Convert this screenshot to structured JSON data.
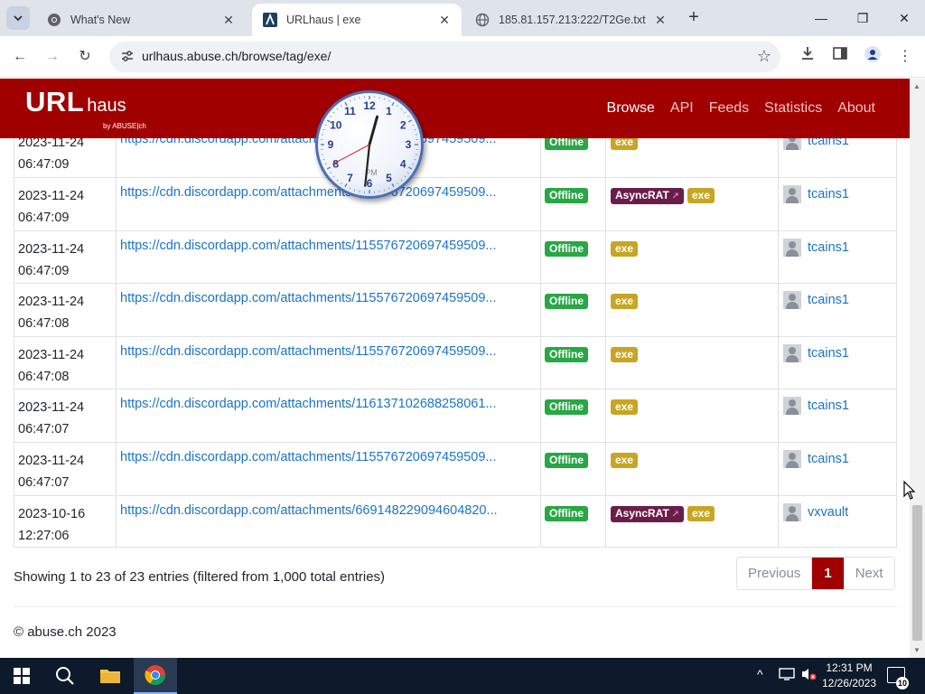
{
  "browser": {
    "tabs": [
      {
        "title": "What's New",
        "active": false
      },
      {
        "title": "URLhaus | exe",
        "active": true
      },
      {
        "title": "185.81.157.213:222/T2Ge.txt",
        "active": false
      }
    ],
    "url": "urlhaus.abuse.ch/browse/tag/exe/"
  },
  "site": {
    "logo_main": "URL",
    "logo_sub": "haus",
    "logo_by": "by ABUSE|ch",
    "nav": [
      "Browse",
      "API",
      "Feeds",
      "Statistics",
      "About"
    ],
    "active_nav": "Browse"
  },
  "table": {
    "rows": [
      {
        "date": "2023-11-24",
        "time": "06:47:09",
        "url": "https://cdn.discordapp.com/attachments/115576720697459509...",
        "status": "Offline",
        "tags": [
          "exe"
        ],
        "reporter": "tcains1"
      },
      {
        "date": "2023-11-24",
        "time": "06:47:09",
        "url": "https://cdn.discordapp.com/attachments/115576720697459509...",
        "status": "Offline",
        "tags": [
          "AsyncRAT",
          "exe"
        ],
        "reporter": "tcains1"
      },
      {
        "date": "2023-11-24",
        "time": "06:47:09",
        "url": "https://cdn.discordapp.com/attachments/115576720697459509...",
        "status": "Offline",
        "tags": [
          "exe"
        ],
        "reporter": "tcains1"
      },
      {
        "date": "2023-11-24",
        "time": "06:47:08",
        "url": "https://cdn.discordapp.com/attachments/115576720697459509...",
        "status": "Offline",
        "tags": [
          "exe"
        ],
        "reporter": "tcains1"
      },
      {
        "date": "2023-11-24",
        "time": "06:47:08",
        "url": "https://cdn.discordapp.com/attachments/115576720697459509...",
        "status": "Offline",
        "tags": [
          "exe"
        ],
        "reporter": "tcains1"
      },
      {
        "date": "2023-11-24",
        "time": "06:47:07",
        "url": "https://cdn.discordapp.com/attachments/116137102688258061...",
        "status": "Offline",
        "tags": [
          "exe"
        ],
        "reporter": "tcains1"
      },
      {
        "date": "2023-11-24",
        "time": "06:47:07",
        "url": "https://cdn.discordapp.com/attachments/115576720697459509...",
        "status": "Offline",
        "tags": [
          "exe"
        ],
        "reporter": "tcains1"
      },
      {
        "date": "2023-10-16",
        "time": "12:27:06",
        "url": "https://cdn.discordapp.com/attachments/669148229094604820...",
        "status": "Offline",
        "tags": [
          "AsyncRAT",
          "exe"
        ],
        "reporter": "vxvault"
      }
    ]
  },
  "pagination": {
    "info": "Showing 1 to 23 of 23 entries (filtered from 1,000 total entries)",
    "previous": "Previous",
    "current": "1",
    "next": "Next"
  },
  "footer": {
    "copyright": "© abuse.ch 2023"
  },
  "desktop_clock": {
    "numbers": [
      "12",
      "1",
      "2",
      "3",
      "4",
      "5",
      "6",
      "7",
      "8",
      "9",
      "10",
      "11"
    ],
    "ampm": "PM"
  },
  "taskbar": {
    "time": "12:31 PM",
    "date": "12/26/2023",
    "notifications": "10"
  },
  "colors": {
    "brand_red": "#a00000",
    "offline_green": "#28a745",
    "asyncrat_purple": "#6b1d4a",
    "exe_gold": "#c8a624",
    "link_blue": "#1a73c8"
  }
}
